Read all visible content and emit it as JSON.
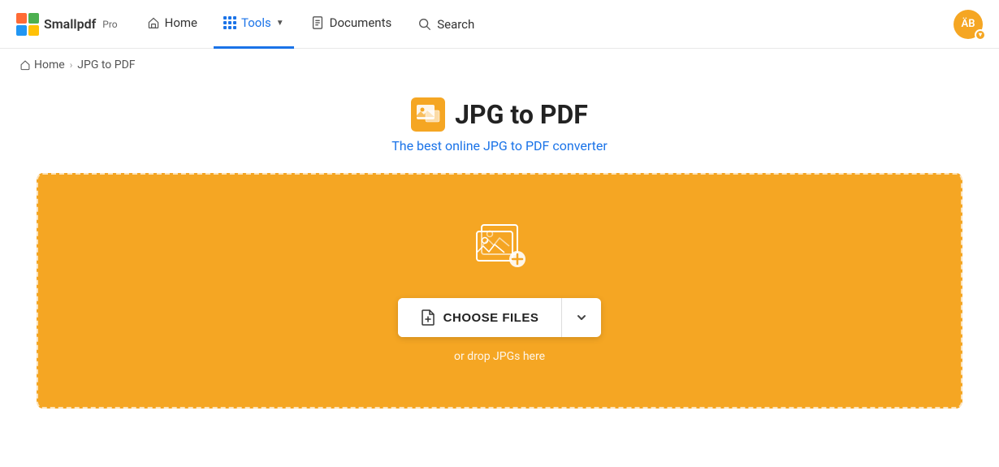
{
  "brand": {
    "logo_text": "Smallpdf",
    "pro_label": "Pro",
    "accent_color": "#f5a623",
    "brand_color": "#1a73e8"
  },
  "nav": {
    "items": [
      {
        "id": "home",
        "label": "Home",
        "icon": "home-icon",
        "active": false
      },
      {
        "id": "tools",
        "label": "Tools",
        "icon": "grid-icon",
        "active": true,
        "has_dropdown": true
      },
      {
        "id": "documents",
        "label": "Documents",
        "icon": "document-icon",
        "active": false
      },
      {
        "id": "search",
        "label": "Search",
        "icon": "search-icon",
        "active": false
      }
    ],
    "user_avatar": "ÄB",
    "user_avatar_color": "#f5a623"
  },
  "breadcrumb": {
    "home_label": "Home",
    "separator": "›",
    "current_label": "JPG to PDF"
  },
  "page": {
    "title": "JPG to PDF",
    "subtitle": "The best online JPG to PDF converter"
  },
  "dropzone": {
    "background_color": "#f5a623",
    "choose_files_label": "CHOOSE FILES",
    "drop_hint": "or drop JPGs here"
  }
}
